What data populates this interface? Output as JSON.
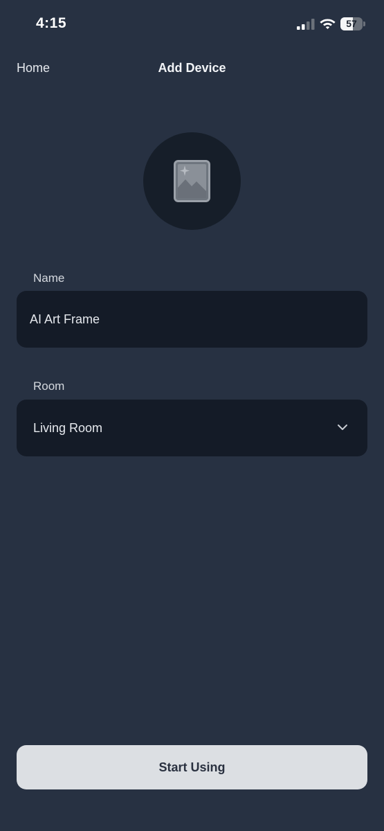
{
  "status_bar": {
    "time": "4:15",
    "battery_level": 57,
    "battery_label": "57",
    "icons": [
      "signal-icon",
      "wifi-icon",
      "battery-icon"
    ]
  },
  "nav": {
    "back_label": "Home",
    "title": "Add Device"
  },
  "device": {
    "icon": "picture-frame-icon"
  },
  "form": {
    "name_label": "Name",
    "name_value": "AI Art Frame",
    "room_label": "Room",
    "room_value": "Living Room",
    "room_dropdown_icon": "chevron-down-icon"
  },
  "actions": {
    "start_label": "Start Using"
  },
  "colors": {
    "background": "#273142",
    "field_background": "#141b27",
    "avatar_background": "#161e29",
    "button_background": "#dcdfe3",
    "button_text": "#2a3140"
  }
}
